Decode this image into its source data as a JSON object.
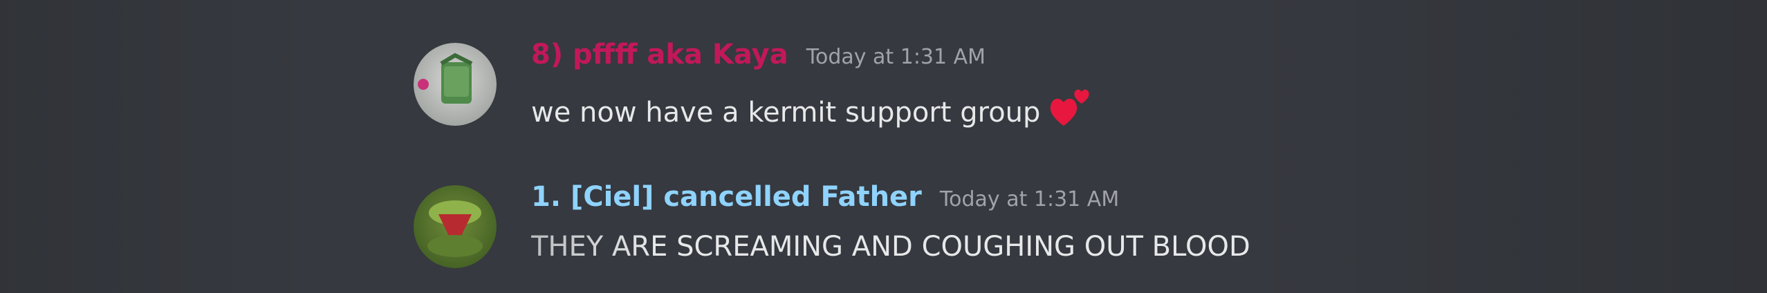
{
  "messages": [
    {
      "username": "8) pffff aka Kaya",
      "timestamp": "Today at 1:31 AM",
      "text": "we now have a kermit support group",
      "username_color": "#c2185b",
      "avatar_icon": "green-gift-avatar",
      "emoji": "two-hearts-emoji"
    },
    {
      "username": "1. [Ciel] cancelled Father",
      "timestamp": "Today at 1:31 AM",
      "text": "THEY ARE SCREAMING AND COUGHING OUT BLOOD",
      "username_color": "#8fd3ff",
      "avatar_icon": "kermit-avatar"
    }
  ],
  "colors": {
    "background": "#36393f",
    "message_text": "#e7e8ea",
    "timestamp_text": "#a1a3a8"
  }
}
